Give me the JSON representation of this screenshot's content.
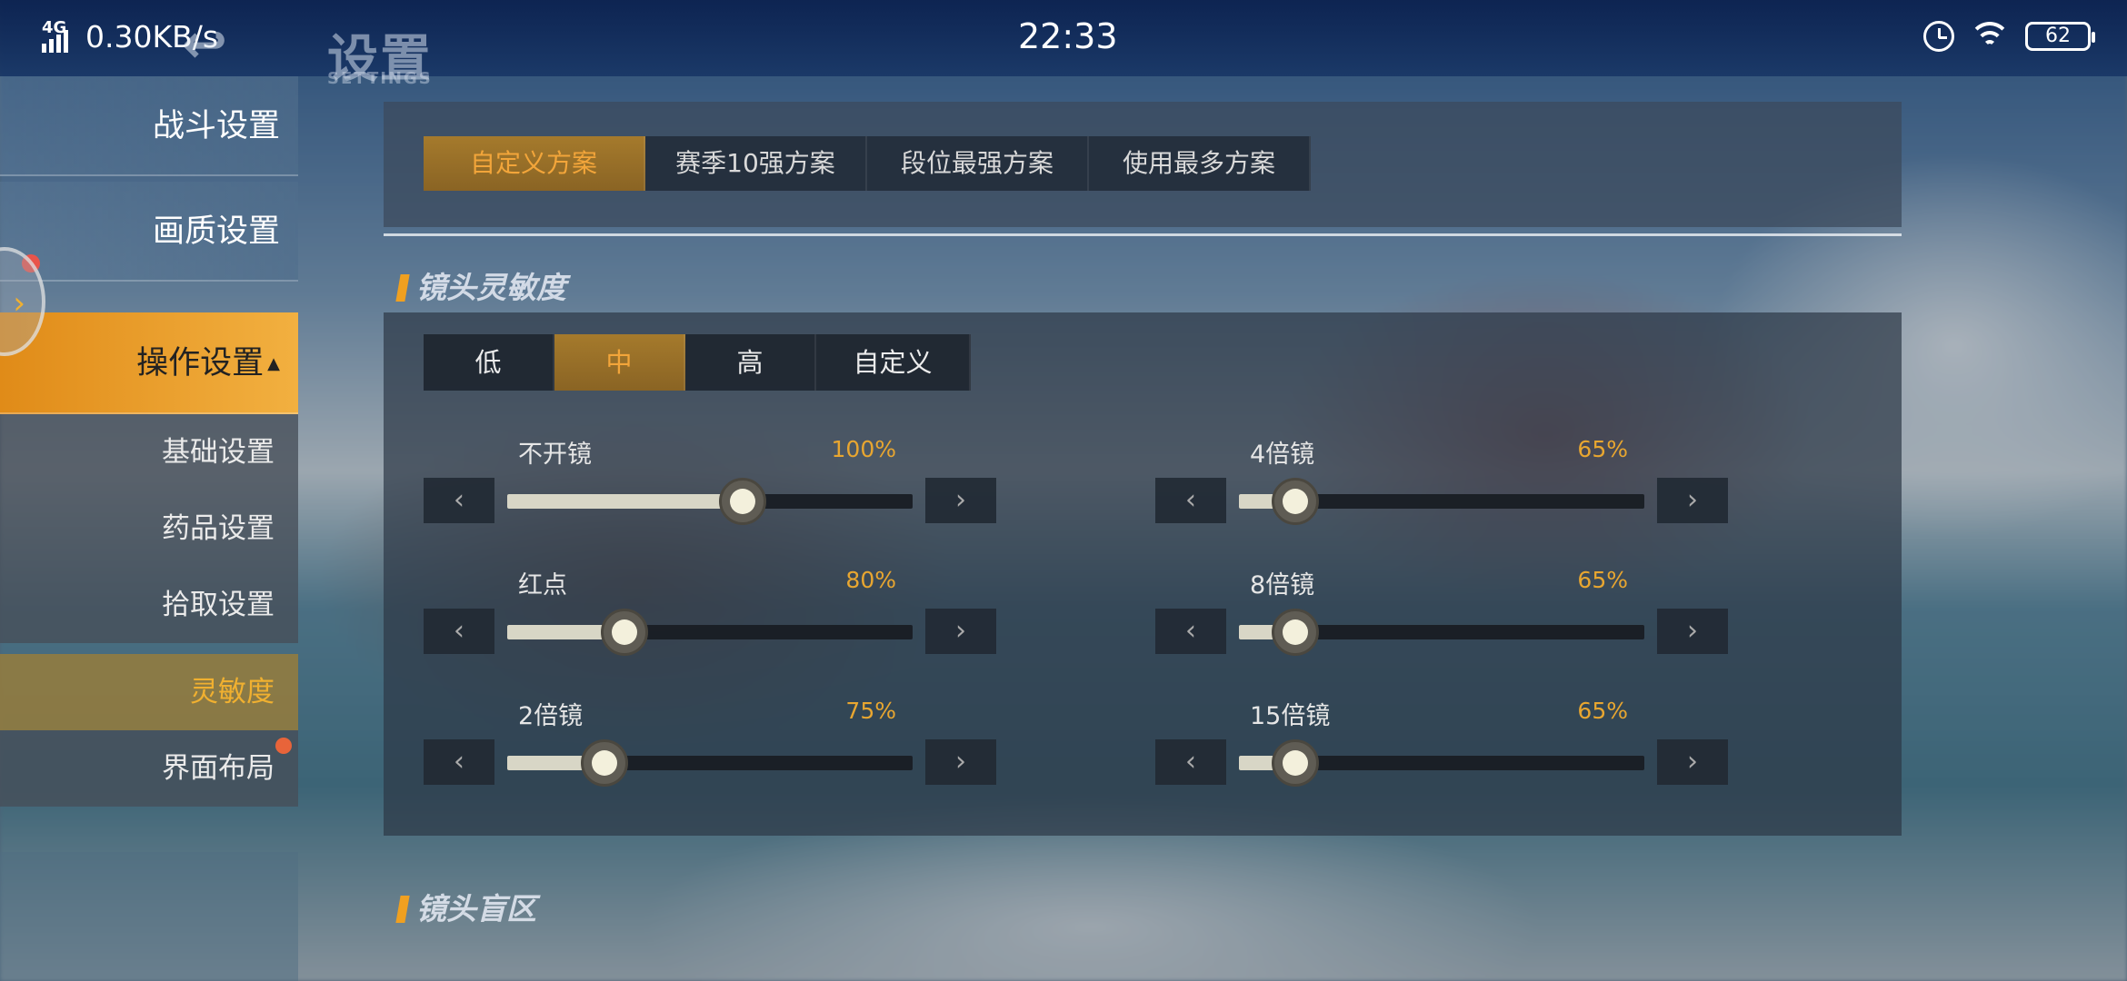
{
  "status_bar": {
    "network": "4G",
    "speed": "0.30KB/s",
    "time": "22:33",
    "battery": "62"
  },
  "header": {
    "title": "设置",
    "subtitle": "SETTINGS"
  },
  "sidebar": {
    "items": [
      {
        "label": "战斗设置"
      },
      {
        "label": "画质设置"
      },
      {
        "label": "操作设置"
      }
    ],
    "sub_items": [
      {
        "label": "基础设置"
      },
      {
        "label": "药品设置"
      },
      {
        "label": "拾取设置"
      },
      {
        "label": "灵敏度"
      },
      {
        "label": "界面布局"
      }
    ]
  },
  "schemes": {
    "tabs": [
      {
        "label": "自定义方案"
      },
      {
        "label": "赛季10强方案"
      },
      {
        "label": "段位最强方案"
      },
      {
        "label": "使用最多方案"
      }
    ]
  },
  "camera_sensitivity": {
    "title": "镜头灵敏度",
    "levels": [
      {
        "label": "低"
      },
      {
        "label": "中"
      },
      {
        "label": "高"
      },
      {
        "label": "自定义"
      }
    ],
    "sliders": [
      {
        "label": "不开镜",
        "value_text": "100%",
        "fraction": 0.58
      },
      {
        "label": "红点",
        "value_text": "80%",
        "fraction": 0.29
      },
      {
        "label": "2倍镜",
        "value_text": "75%",
        "fraction": 0.24
      },
      {
        "label": "4倍镜",
        "value_text": "65%",
        "fraction": 0.14
      },
      {
        "label": "8倍镜",
        "value_text": "65%",
        "fraction": 0.14
      },
      {
        "label": "15倍镜",
        "value_text": "65%",
        "fraction": 0.14
      }
    ]
  },
  "camera_blind_zone": {
    "title": "镜头盲区"
  },
  "colors": {
    "accent": "#f0a020",
    "active_tab_text": "#f2a53a",
    "value_text": "#e8a630",
    "badge_red": "#e9544a"
  }
}
